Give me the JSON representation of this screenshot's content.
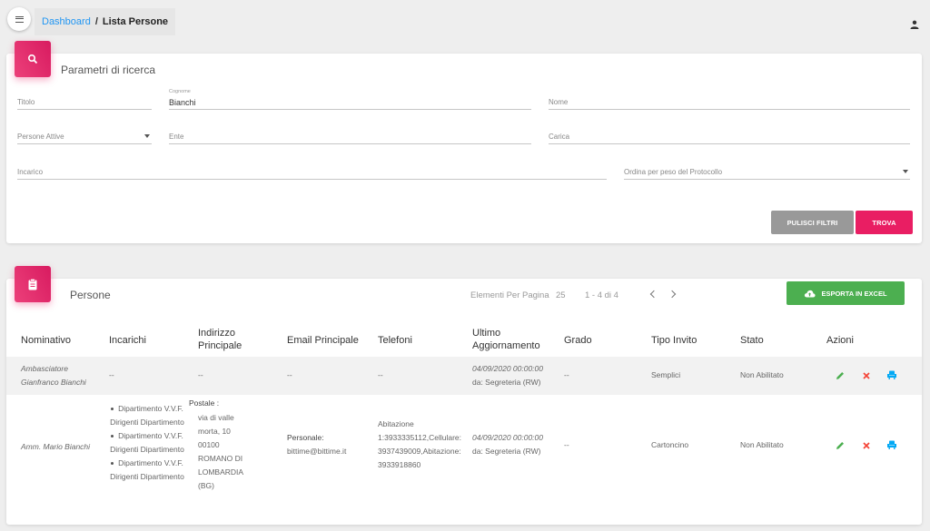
{
  "breadcrumb": {
    "parent": "Dashboard",
    "separator": "/",
    "current": "Lista Persone"
  },
  "search": {
    "title": "Parametri di ricerca",
    "fields": {
      "titolo": {
        "label": "Titolo",
        "value": ""
      },
      "cognome": {
        "label": "Cognome",
        "value": "Bianchi"
      },
      "nome": {
        "label": "Nome",
        "value": ""
      },
      "persone_attive": {
        "label": "Persone Attive",
        "value": ""
      },
      "ente": {
        "label": "Ente",
        "value": ""
      },
      "carica": {
        "label": "Carica",
        "value": ""
      },
      "incarico": {
        "label": "Incarico",
        "value": ""
      },
      "ordina": {
        "label": "Ordina per peso del Protocollo",
        "value": ""
      }
    },
    "buttons": {
      "clear": "PULISCI FILTRI",
      "find": "TROVA"
    }
  },
  "list": {
    "title": "Persone",
    "per_page_label": "Elementi Per Pagina",
    "per_page_value": "25",
    "range": "1 - 4 di 4",
    "export_label": "ESPORTA IN EXCEL",
    "columns": {
      "nominativo": "Nominativo",
      "incarichi": "Incarichi",
      "indirizzo": "Indirizzo Principale",
      "email": "Email Principale",
      "telefoni": "Telefoni",
      "aggiornamento": "Ultimo Aggiornamento",
      "grado": "Grado",
      "tipo_invito": "Tipo Invito",
      "stato": "Stato",
      "azioni": "Azioni"
    },
    "rows": [
      {
        "nominativo": "Ambasciatore Gianfranco Bianchi",
        "incarichi": "--",
        "indirizzo": "--",
        "email": "--",
        "telefoni": "--",
        "data": "04/09/2020 00:00:00",
        "da": "da: Segreteria (RW)",
        "grado": "--",
        "tipo_invito": "Semplici",
        "stato": "Non Abilitato"
      },
      {
        "nominativo": "Amm. Mario Bianchi",
        "incarichi": [
          {
            "line1": "Dipartimento V.V.F.",
            "line2": "Dirigenti Dipartimento"
          },
          {
            "line1": "Dipartimento V.V.F.",
            "line2": "Dirigenti Dipartimento"
          },
          {
            "line1": "Dipartimento V.V.F.",
            "line2": "Dirigenti Dipartimento"
          }
        ],
        "indirizzo_label": "Postale :",
        "indirizzo_lines": [
          "via di valle",
          "morta, 10",
          "00100",
          "ROMANO DI",
          "LOMBARDIA",
          "(BG)"
        ],
        "email_label": "Personale:",
        "email": "bittime@bittime.it",
        "telefoni_lines": [
          "Abitazione",
          "1:3933335112,Cellulare:",
          "3937439009,Abitazione:",
          "3933918860"
        ],
        "data": "04/09/2020 00:00:00",
        "da": "da: Segreteria (RW)",
        "grado": "--",
        "tipo_invito": "Cartoncino",
        "stato": "Non Abilitato"
      }
    ]
  },
  "colors": {
    "pink": "#e91e63",
    "green": "#4caf50",
    "grey_button": "#999999",
    "link": "#2196f3",
    "edit": "#4caf50",
    "delete": "#f44336",
    "ticket": "#03a9f4"
  },
  "icons": [
    "menu-icon",
    "user-icon",
    "search-icon",
    "clipboard-icon",
    "chevron-left-icon",
    "chevron-right-icon",
    "cloud-upload-icon",
    "edit-icon",
    "delete-icon",
    "seat-icon"
  ]
}
